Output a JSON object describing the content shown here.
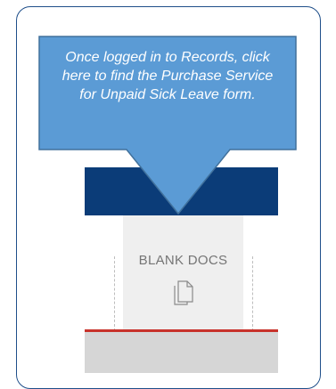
{
  "callout": {
    "text": "Once logged in to Records, click here to find the Purchase Service for Unpaid Sick Leave form."
  },
  "tile": {
    "label": "BLANK DOCS",
    "icon": "documents-icon"
  },
  "colors": {
    "frame_border": "#1f4f8a",
    "callout_fill": "#5b9bd5",
    "callout_border": "#41719c",
    "dark_band": "#0b3c78",
    "tile_bg": "#efefef",
    "accent_red": "#c8322b",
    "bottom_strip": "#d6d6d6"
  }
}
